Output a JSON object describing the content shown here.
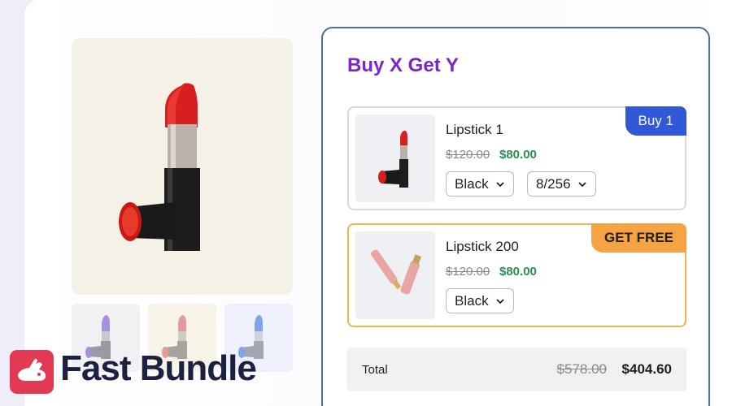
{
  "bundle": {
    "title": "Buy X Get Y",
    "items": [
      {
        "name": "Lipstick 1",
        "price_old": "$120.00",
        "price_new": "$80.00",
        "badge": "Buy 1",
        "options": [
          "Black",
          "8/256"
        ]
      },
      {
        "name": "Lipstick 200",
        "price_old": "$120.00",
        "price_new": "$80.00",
        "badge": "GET FREE",
        "options": [
          "Black"
        ]
      }
    ],
    "total": {
      "label": "Total",
      "old": "$578.00",
      "new": "$404.60"
    }
  },
  "brand": {
    "name": "Fast Bundle"
  },
  "colors": {
    "title": "#7a26c9",
    "buy_badge": "#3158d6",
    "free_badge": "#f6a443",
    "sale_price": "#2a8f4e",
    "brand_logo": "#e23a55"
  },
  "icons": {
    "product_main": "red-lipstick-icon",
    "thumb_1": "purple-lipstick-icon",
    "thumb_2": "pink-lipstick-icon",
    "thumb_3": "blue-lipstick-icon",
    "item_2": "lip-gloss-icon",
    "select": "chevron-down-icon",
    "logo": "rabbit-icon"
  }
}
